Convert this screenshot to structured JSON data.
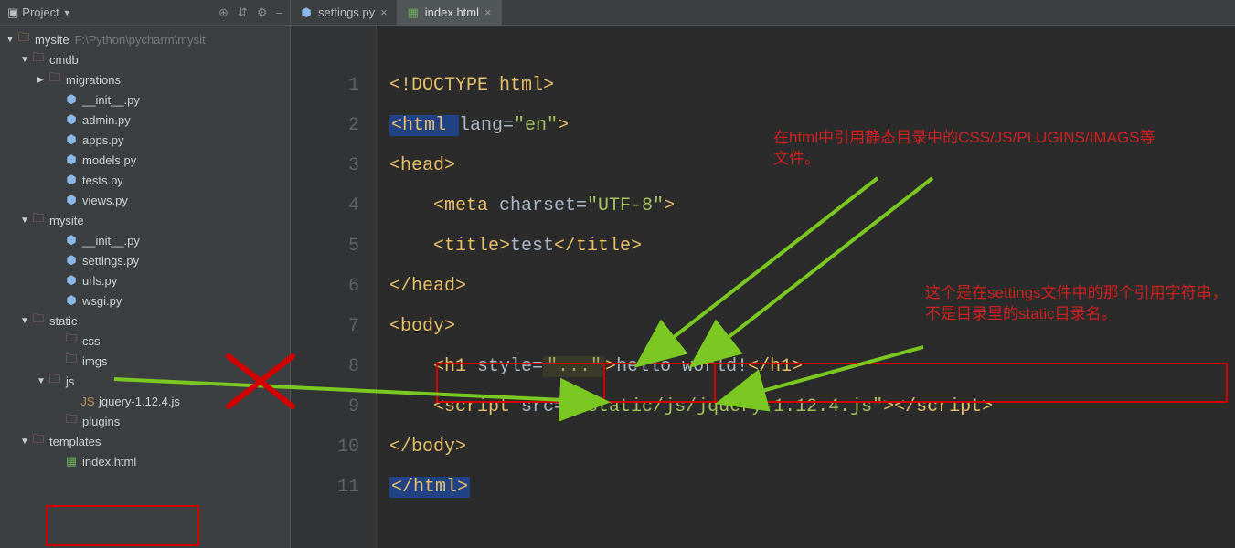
{
  "sidebar": {
    "title": "Project",
    "toolbar_icons": [
      "target-icon",
      "collapse-icon",
      "gear-icon",
      "hide-icon"
    ],
    "tree": [
      {
        "label": "mysite",
        "type": "folder",
        "indent": 0,
        "arrow": "▼",
        "path": "F:\\Python\\pycharm\\mysit"
      },
      {
        "label": "cmdb",
        "type": "folder-red",
        "indent": 1,
        "arrow": "▼"
      },
      {
        "label": "migrations",
        "type": "folder-red",
        "indent": 2,
        "arrow": "▶"
      },
      {
        "label": "__init__.py",
        "type": "py",
        "indent": 3
      },
      {
        "label": "admin.py",
        "type": "py",
        "indent": 3
      },
      {
        "label": "apps.py",
        "type": "py",
        "indent": 3
      },
      {
        "label": "models.py",
        "type": "py",
        "indent": 3
      },
      {
        "label": "tests.py",
        "type": "py",
        "indent": 3
      },
      {
        "label": "views.py",
        "type": "py",
        "indent": 3
      },
      {
        "label": "mysite",
        "type": "folder-red",
        "indent": 1,
        "arrow": "▼"
      },
      {
        "label": "__init__.py",
        "type": "py",
        "indent": 3
      },
      {
        "label": "settings.py",
        "type": "py",
        "indent": 3
      },
      {
        "label": "urls.py",
        "type": "py",
        "indent": 3
      },
      {
        "label": "wsgi.py",
        "type": "py",
        "indent": 3
      },
      {
        "label": "static",
        "type": "folder-red",
        "indent": 1,
        "arrow": "▼"
      },
      {
        "label": "css",
        "type": "folder-red",
        "indent": 3
      },
      {
        "label": "imgs",
        "type": "folder-red",
        "indent": 3
      },
      {
        "label": "js",
        "type": "folder-red",
        "indent": 2,
        "arrow": "▼"
      },
      {
        "label": "jquery-1.12.4.js",
        "type": "js",
        "indent": 4
      },
      {
        "label": "plugins",
        "type": "folder-red",
        "indent": 3
      },
      {
        "label": "templates",
        "type": "folder-red",
        "indent": 1,
        "arrow": "▼"
      },
      {
        "label": "index.html",
        "type": "html",
        "indent": 3
      }
    ]
  },
  "tabs": [
    {
      "label": "settings.py",
      "icon": "py",
      "active": false
    },
    {
      "label": "index.html",
      "icon": "html",
      "active": true
    }
  ],
  "gutter_lines": [
    "1",
    "2",
    "3",
    "4",
    "5",
    "6",
    "7",
    "8",
    "9",
    "10",
    "11"
  ],
  "code": {
    "l1": "<!DOCTYPE html>",
    "l2_open": "<html ",
    "l2_attr": "lang=",
    "l2_val": "\"en\"",
    "l2_close": ">",
    "l3": "<head>",
    "l4_open": "    <meta ",
    "l4_attr": "charset=",
    "l4_val": "\"UTF-8\"",
    "l4_close": ">",
    "l5_open": "    <title>",
    "l5_text": "test",
    "l5_close": "</title>",
    "l6": "</head>",
    "l7": "<body>",
    "l8_open": "    <h1 ",
    "l8_attr": "style=",
    "l8_fold": "\"...\"",
    "l8_mid": ">",
    "l8_text": "hello world!",
    "l8_close": "</h1>",
    "l9_open": "    <script ",
    "l9_attr": "src=",
    "l9_val": "\"/static/js/jquery-1.12.4.js\"",
    "l9_mid": ">",
    "l9_close": "</script>",
    "l10": "</body>",
    "l11": "</html>"
  },
  "annotations": {
    "a1": "在html中引用静态目录中的CSS/JS/PLUGINS/IMAGS等文件。",
    "a2": "这个是在settings文件中的那个引用字符串，不是目录里的static目录名。"
  }
}
